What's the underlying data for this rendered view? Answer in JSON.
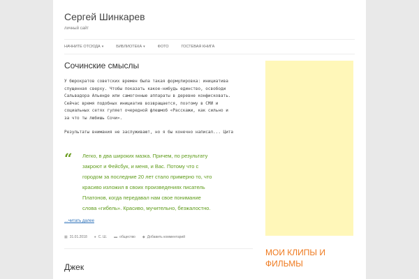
{
  "site": {
    "title": "Сергей Шинкарев",
    "description": "личный сайт"
  },
  "nav": {
    "items": [
      {
        "label": "НАЧНИТЕ ОТСЮДА",
        "has_dropdown": true
      },
      {
        "label": "БИБЛИОТЕКА",
        "has_dropdown": true
      },
      {
        "label": "ФОТО",
        "has_dropdown": false
      },
      {
        "label": "ГОСТЕВАЯ КНИГА",
        "has_dropdown": false
      }
    ]
  },
  "post": {
    "title": "Сочинские смыслы",
    "body_lines": [
      "У бюрократов советских времен была такая формулировка: инициатива",
      "спущенная сверху. Чтобы показать какое-нибудь единство, освободи",
      "Сальвадора Альенде или самогонные аппараты в деревне конфисковать.",
      "Сейчас время подобных инициатив возвращается, поэтому в СМИ и",
      "социальных сетях гуляет очередной флешмоб «Расскажи, как сильно и",
      "за что ты любишь Сочи»."
    ],
    "paragraph2": "Результаты внимания не заслуживают, но я бы конечно написал... Цита",
    "quote_lines": [
      "Легко, в два широких мазка. Причем, по результату",
      "закроют и Фейсбук, и меня, и Вас. Потому что с",
      "городом за последние 20 лет стало примерно то, что",
      "красиво изложил в своих произведениях писатель",
      "Платонов, когда передавал нам свое понимание",
      "слова «гибель». Красиво, мучительно, безжалостно."
    ],
    "read_more": "…читать далее",
    "meta": {
      "date": "31.01.2018",
      "author": "С. Ш.",
      "category": "общество",
      "comments": "Добавить комментарий"
    }
  },
  "post2": {
    "title": "Джек"
  },
  "sidebar": {
    "widget_title": "МОИ КЛИПЫ И ФИЛЬМЫ"
  },
  "colors": {
    "accent_green": "#5e9b1a",
    "link_blue": "#2a6fb8",
    "widget_orange": "#ef7a1f",
    "ad_yellow": "#fff7b9"
  }
}
